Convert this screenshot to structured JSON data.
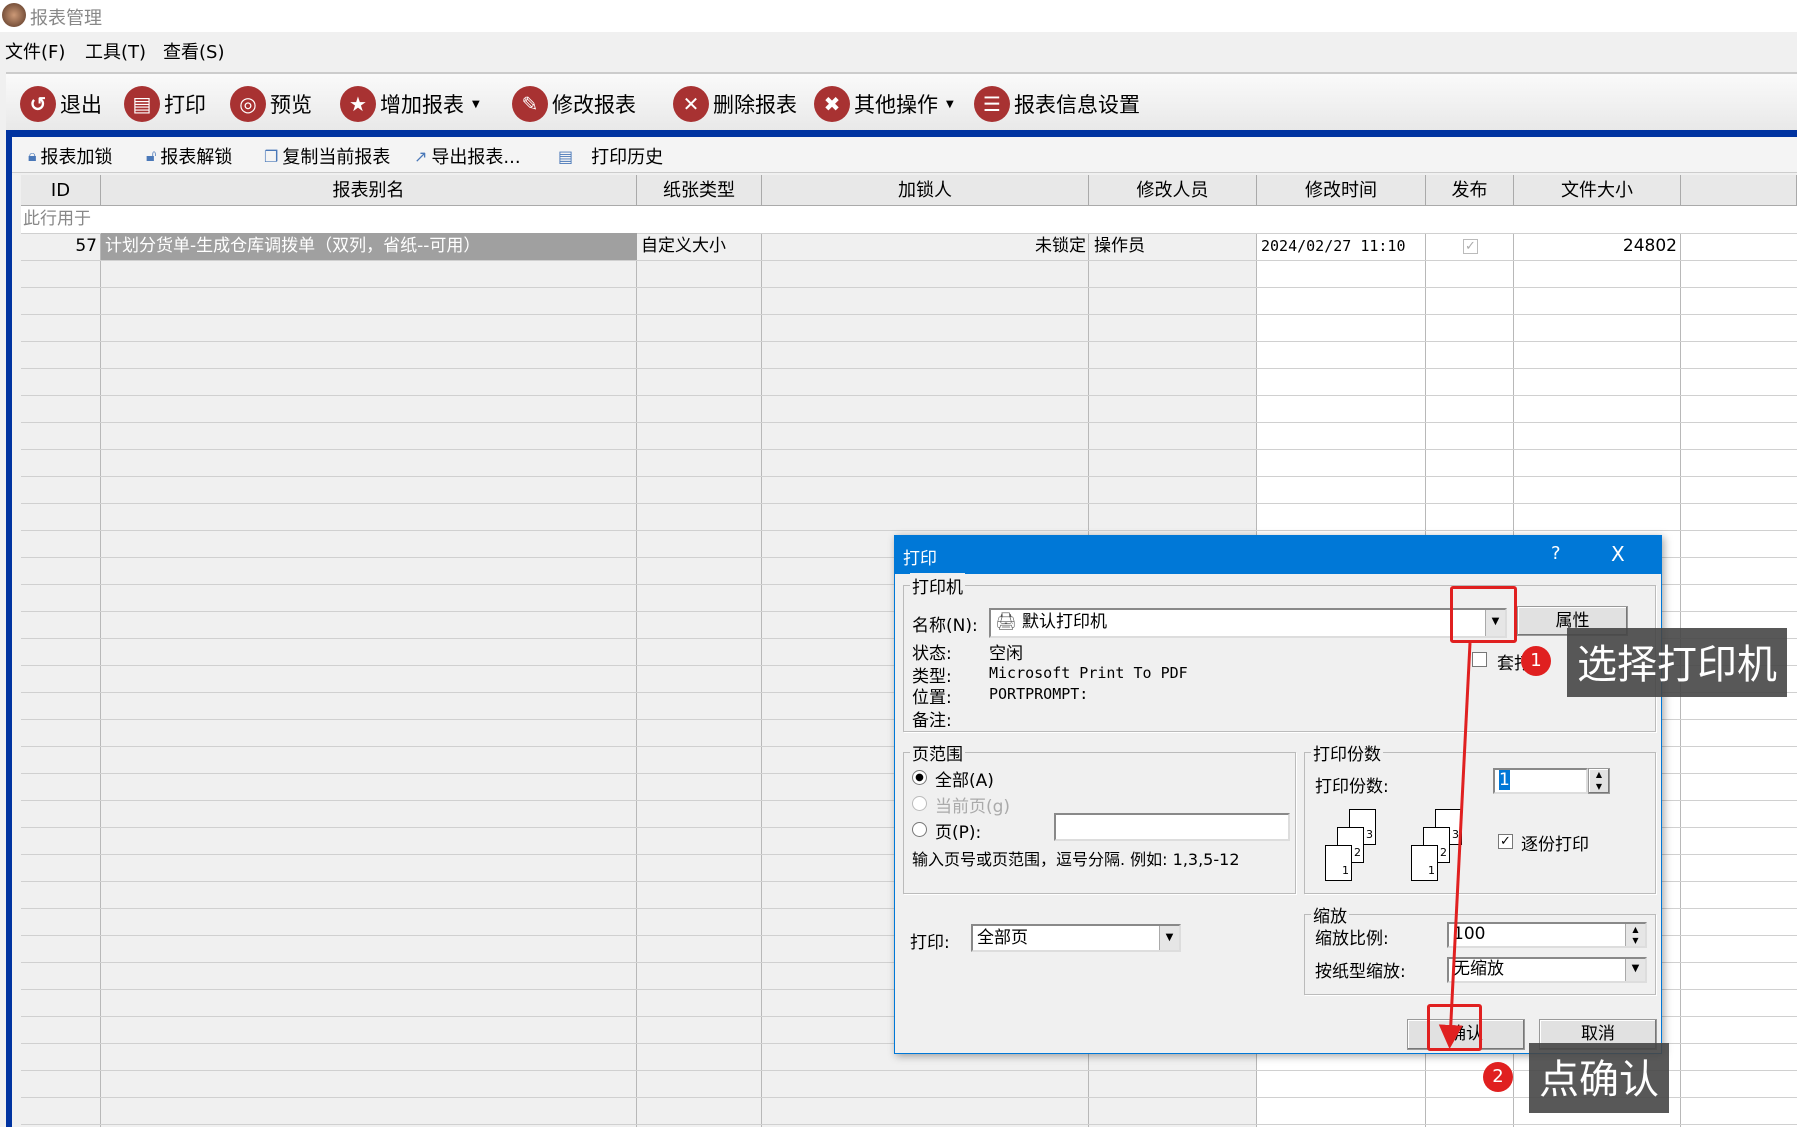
{
  "window": {
    "title": "报表管理"
  },
  "menu": [
    "文件(F)",
    "工具(T)",
    "查看(S)"
  ],
  "toolbar": [
    {
      "label": "退出",
      "icon": "exit-icon"
    },
    {
      "label": "打印",
      "icon": "printer-icon"
    },
    {
      "label": "预览",
      "icon": "preview-icon"
    },
    {
      "label": "增加报表",
      "icon": "star-icon",
      "dropdown": true
    },
    {
      "label": "修改报表",
      "icon": "edit-icon"
    },
    {
      "label": "删除报表",
      "icon": "delete-icon"
    },
    {
      "label": "其他操作",
      "icon": "tools-icon",
      "dropdown": true
    },
    {
      "label": "报表信息设置",
      "icon": "clipboard-icon"
    }
  ],
  "subtoolbar": [
    "报表加锁",
    "报表解锁",
    "复制当前报表",
    "导出报表...",
    "打印历史"
  ],
  "table": {
    "columns": [
      "ID",
      "报表别名",
      "纸张类型",
      "加锁人",
      "修改人员",
      "修改时间",
      "发布",
      "文件大小"
    ],
    "filter_row_text": "此行用于",
    "rows": [
      {
        "id": "57",
        "name": "计划分货单-生成仓库调拨单（双列，省纸--可用）",
        "paper": "自定义大小",
        "locker": "未锁定",
        "modifier": "操作员",
        "time": "2024/02/27 11:10",
        "published": true,
        "size": "24802"
      }
    ]
  },
  "dialog": {
    "title": "打印",
    "help": "?",
    "close": "X",
    "printer_group": "打印机",
    "name_label": "名称(N):",
    "printer_name": "默认打印机",
    "properties_button": "属性",
    "status_label": "状态:",
    "status_value": "空闲",
    "type_label": "类型:",
    "type_value": "Microsoft Print To PDF",
    "location_label": "位置:",
    "location_value": "PORTPROMPT:",
    "comment_label": "备注:",
    "overlay_print_label": "套打",
    "range_group": "页范围",
    "range_all": "全部(A)",
    "range_current": "当前页(g)",
    "range_pages": "页(P):",
    "range_hint": "输入页号或页范围，逗号分隔. 例如: 1,3,5-12",
    "copies_group": "打印份数",
    "copies_label": "打印份数:",
    "copies_value": "1",
    "collate_label": "逐份打印",
    "collate_checked": true,
    "print_label": "打印:",
    "print_value": "全部页",
    "scale_group": "缩放",
    "scale_label": "缩放比例:",
    "scale_value": "100",
    "paper_scale_label": "按纸型缩放:",
    "paper_scale_value": "无缩放",
    "ok_button": "确认",
    "cancel_button": "取消"
  },
  "annotations": [
    {
      "number": "1",
      "text": "选择打印机"
    },
    {
      "number": "2",
      "text": "点确认"
    }
  ],
  "colors": {
    "dialog_title": "#0078d7",
    "annotation_red": "#e02020",
    "toolbar_icon": "#a83232"
  }
}
